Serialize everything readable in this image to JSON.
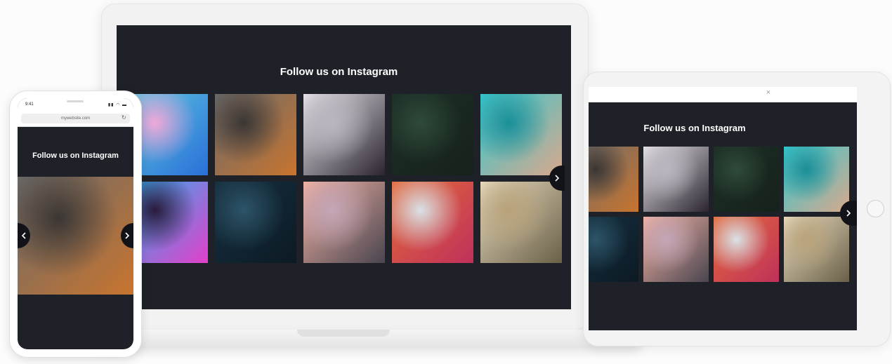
{
  "widget": {
    "title": "Follow us on Instagram",
    "next_label": "›",
    "prev_label": "‹"
  },
  "phone": {
    "status_time": "9:41",
    "status_icons": "▮▮ ◠ ▬",
    "url": "mywebsite.com",
    "reload_icon": "↻"
  },
  "tablet": {
    "close_label": "×"
  },
  "photos": [
    {
      "name": "fluid-art",
      "colors": [
        "#5ec8e0",
        "#f0a8d8",
        "#2a6fd8"
      ]
    },
    {
      "name": "man-sitting",
      "colors": [
        "#6b6b6b",
        "#3a3634",
        "#c8742e"
      ]
    },
    {
      "name": "woman-swimsuit-city",
      "colors": [
        "#e7e4ea",
        "#bcb6c0",
        "#2c2530"
      ]
    },
    {
      "name": "fern-leaves",
      "colors": [
        "#1c2e25",
        "#2f4a3a",
        "#16221b"
      ]
    },
    {
      "name": "woman-pool",
      "colors": [
        "#33c7cf",
        "#1a8f98",
        "#d9a88c"
      ]
    },
    {
      "name": "neon-portrait",
      "colors": [
        "#2ab3f0",
        "#2a1a3c",
        "#e23fc9"
      ]
    },
    {
      "name": "city-alley",
      "colors": [
        "#163040",
        "#2d5468",
        "#0c1a24"
      ]
    },
    {
      "name": "sunset-beach",
      "colors": [
        "#f2b3a3",
        "#c4a6b8",
        "#4a4550"
      ]
    },
    {
      "name": "store-shelves",
      "colors": [
        "#e36b3a",
        "#d9e2e6",
        "#c0305a"
      ]
    },
    {
      "name": "dome-ceiling",
      "colors": [
        "#e8dcc0",
        "#b9a27a",
        "#6a6048"
      ]
    }
  ]
}
